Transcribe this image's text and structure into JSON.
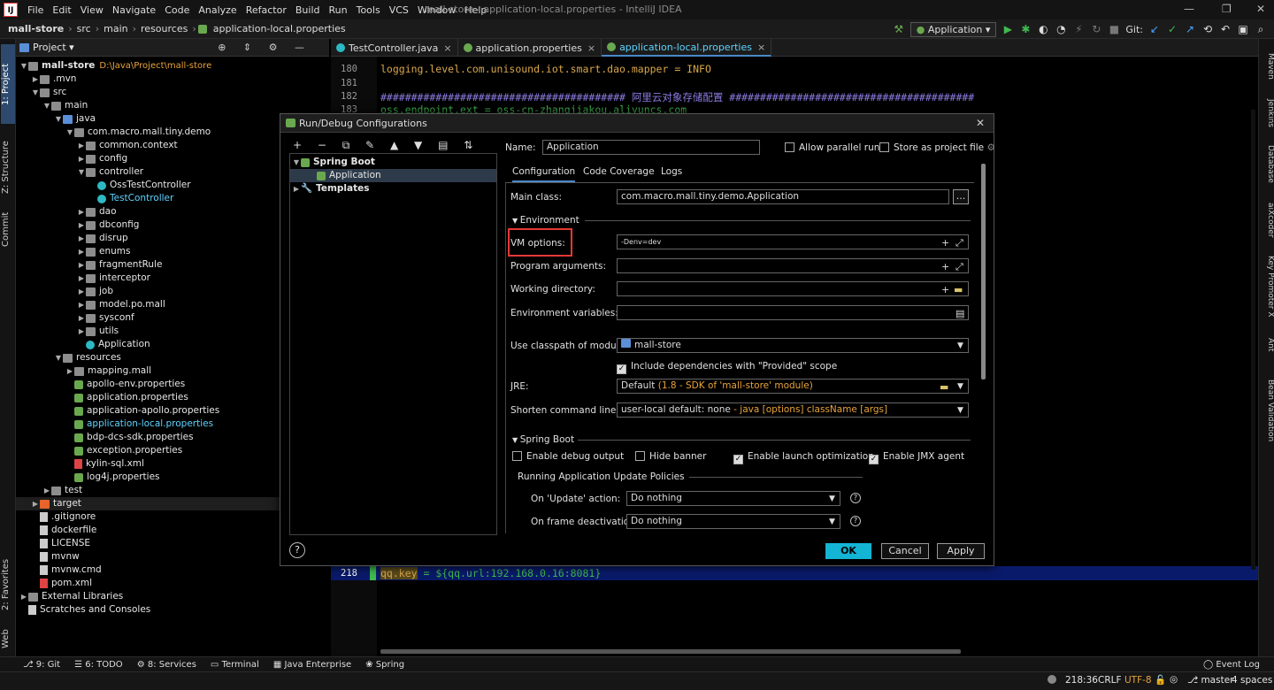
{
  "menubar": {
    "logo": "IJ",
    "items": [
      "File",
      "Edit",
      "View",
      "Navigate",
      "Code",
      "Analyze",
      "Refactor",
      "Build",
      "Run",
      "Tools",
      "VCS",
      "Window",
      "Help"
    ],
    "title": "mall-store - application-local.properties - IntelliJ IDEA",
    "minimize": "—",
    "maximize": "❐",
    "close": "✕"
  },
  "navbar": {
    "crumbs": [
      "mall-store",
      "src",
      "main",
      "resources",
      "application-local.properties"
    ],
    "run_config": "Application",
    "git_label": "Git:"
  },
  "left_strip": {
    "project": "1: Project",
    "structure": "Z: Structure",
    "commit": "Commit",
    "favorites": "2: Favorites",
    "web": "Web"
  },
  "right_strip": [
    "Maven",
    "Jenkins",
    "Database",
    "aiXcoder",
    "Key Promoter X",
    "Ant",
    "Bean Validation"
  ],
  "project_panel": {
    "header": "Project",
    "tree": [
      {
        "label": "mall-store",
        "suffix": "D:\\Java\\Project\\mall-store",
        "depth": 0,
        "arrow": "▼",
        "icon": "folder",
        "bold": true
      },
      {
        "label": ".mvn",
        "depth": 1,
        "arrow": "▶",
        "icon": "folder"
      },
      {
        "label": "src",
        "depth": 1,
        "arrow": "▼",
        "icon": "folder"
      },
      {
        "label": "main",
        "depth": 2,
        "arrow": "▼",
        "icon": "folder"
      },
      {
        "label": "java",
        "depth": 3,
        "arrow": "▼",
        "icon": "folderb"
      },
      {
        "label": "com.macro.mall.tiny.demo",
        "depth": 4,
        "arrow": "▼",
        "icon": "folder"
      },
      {
        "label": "common.context",
        "depth": 5,
        "arrow": "▶",
        "icon": "folder"
      },
      {
        "label": "config",
        "depth": 5,
        "arrow": "▶",
        "icon": "folder"
      },
      {
        "label": "controller",
        "depth": 5,
        "arrow": "▼",
        "icon": "folder"
      },
      {
        "label": "OssTestController",
        "depth": 6,
        "arrow": "",
        "icon": "cls"
      },
      {
        "label": "TestController",
        "depth": 6,
        "arrow": "",
        "icon": "cls",
        "color": "#5fd3ff"
      },
      {
        "label": "dao",
        "depth": 5,
        "arrow": "▶",
        "icon": "folder"
      },
      {
        "label": "dbconfig",
        "depth": 5,
        "arrow": "▶",
        "icon": "folder"
      },
      {
        "label": "disrup",
        "depth": 5,
        "arrow": "▶",
        "icon": "folder"
      },
      {
        "label": "enums",
        "depth": 5,
        "arrow": "▶",
        "icon": "folder"
      },
      {
        "label": "fragmentRule",
        "depth": 5,
        "arrow": "▶",
        "icon": "folder"
      },
      {
        "label": "interceptor",
        "depth": 5,
        "arrow": "▶",
        "icon": "folder"
      },
      {
        "label": "job",
        "depth": 5,
        "arrow": "▶",
        "icon": "folder"
      },
      {
        "label": "model.po.mall",
        "depth": 5,
        "arrow": "▶",
        "icon": "folder"
      },
      {
        "label": "sysconf",
        "depth": 5,
        "arrow": "▶",
        "icon": "folder"
      },
      {
        "label": "utils",
        "depth": 5,
        "arrow": "▶",
        "icon": "folder"
      },
      {
        "label": "Application",
        "depth": 5,
        "arrow": "",
        "icon": "cls"
      },
      {
        "label": "resources",
        "depth": 3,
        "arrow": "▼",
        "icon": "folder"
      },
      {
        "label": "mapping.mall",
        "depth": 4,
        "arrow": "▶",
        "icon": "folder"
      },
      {
        "label": "apollo-env.properties",
        "depth": 4,
        "arrow": "",
        "icon": "spr"
      },
      {
        "label": "application.properties",
        "depth": 4,
        "arrow": "",
        "icon": "spr"
      },
      {
        "label": "application-apollo.properties",
        "depth": 4,
        "arrow": "",
        "icon": "spr"
      },
      {
        "label": "application-local.properties",
        "depth": 4,
        "arrow": "",
        "icon": "spr",
        "color": "#5fd3ff"
      },
      {
        "label": "bdp-dcs-sdk.properties",
        "depth": 4,
        "arrow": "",
        "icon": "spr"
      },
      {
        "label": "exception.properties",
        "depth": 4,
        "arrow": "",
        "icon": "spr"
      },
      {
        "label": "kylin-sql.xml",
        "depth": 4,
        "arrow": "",
        "icon": "xml"
      },
      {
        "label": "log4j.properties",
        "depth": 4,
        "arrow": "",
        "icon": "spr"
      },
      {
        "label": "test",
        "depth": 2,
        "arrow": "▶",
        "icon": "folder"
      },
      {
        "label": "target",
        "depth": 1,
        "arrow": "▶",
        "icon": "folder",
        "highlight": true
      },
      {
        "label": ".gitignore",
        "depth": 1,
        "arrow": "",
        "icon": "file"
      },
      {
        "label": "dockerfile",
        "depth": 1,
        "arrow": "",
        "icon": "file"
      },
      {
        "label": "LICENSE",
        "depth": 1,
        "arrow": "",
        "icon": "file"
      },
      {
        "label": "mvnw",
        "depth": 1,
        "arrow": "",
        "icon": "file"
      },
      {
        "label": "mvnw.cmd",
        "depth": 1,
        "arrow": "",
        "icon": "file"
      },
      {
        "label": "pom.xml",
        "depth": 1,
        "arrow": "",
        "icon": "xml"
      },
      {
        "label": "External Libraries",
        "depth": 0,
        "arrow": "▶",
        "icon": "folder"
      },
      {
        "label": "Scratches and Consoles",
        "depth": 0,
        "arrow": "",
        "icon": "file"
      }
    ]
  },
  "editor": {
    "tabs": [
      {
        "label": "TestController.java",
        "color": "#2db9c4",
        "active": false
      },
      {
        "label": "application.properties",
        "color": "#6aa84f",
        "active": false
      },
      {
        "label": "application-local.properties",
        "color": "#6aa84f",
        "active": true
      }
    ],
    "lines": [
      {
        "n": "180",
        "text": "logging.level.com.unisound.iot.smart.dao.mapper = INFO",
        "color": "#d9a74a"
      },
      {
        "n": "181",
        "text": "",
        "color": "#d9a74a"
      },
      {
        "n": "182",
        "text": "######################################## 阿里云对象存储配置 ########################################",
        "color": "#8b7ae0"
      },
      {
        "n": "183",
        "text": "oss.endpoint.ext = oss-cn-zhangjiakou.aliyuncs.com",
        "color": "#3fb950"
      }
    ],
    "bottom_line": {
      "n": "218",
      "key": "qq.key",
      "rest": " = ${qq.url:192.168.0.16:8081}"
    }
  },
  "dialog": {
    "title": "Run/Debug Configurations",
    "tree": {
      "spring_boot": "Spring Boot",
      "application": "Application",
      "templates": "Templates"
    },
    "name_label": "Name:",
    "name_value": "Application",
    "allow_parallel": "Allow parallel run",
    "store_as_project": "Store as project file",
    "tabs": [
      "Configuration",
      "Code Coverage",
      "Logs"
    ],
    "main_class_label": "Main class:",
    "main_class_value": "com.macro.mall.tiny.demo.Application",
    "environment_section": "Environment",
    "vm_options_label": "VM options:",
    "vm_options_value": "-Denv=dev",
    "program_args_label": "Program arguments:",
    "working_dir_label": "Working directory:",
    "env_vars_label": "Environment variables:",
    "classpath_label": "Use classpath of module:",
    "classpath_value": "mall-store",
    "include_provided": "Include dependencies with \"Provided\" scope",
    "jre_label": "JRE:",
    "jre_value_main": "Default",
    "jre_value_detail": "(1.8 - SDK of 'mall-store' module)",
    "shorten_label": "Shorten command line:",
    "shorten_value_main": "user-local default: none",
    "shorten_value_detail": " - java [options] className [args]",
    "springboot_section": "Spring Boot",
    "enable_debug": "Enable debug output",
    "hide_banner": "Hide banner",
    "enable_launch_opt": "Enable launch optimization",
    "enable_jmx": "Enable JMX agent",
    "update_policies": "Running Application Update Policies",
    "on_update_label": "On 'Update' action:",
    "on_update_value": "Do nothing",
    "on_frame_label": "On frame deactivation:",
    "on_frame_value": "Do nothing",
    "ok": "OK",
    "cancel": "Cancel",
    "apply": "Apply",
    "help": "?"
  },
  "bottom_tabs": [
    "9: Git",
    "6: TODO",
    "8: Services",
    "Terminal",
    "Java Enterprise",
    "Spring"
  ],
  "event_log": "Event Log",
  "status": {
    "position": "218:36",
    "line_sep": "CRLF",
    "encoding": "UTF-8",
    "branch": "master",
    "indent": "4 spaces"
  },
  "colors": {
    "accent": "#4a88c7",
    "highlight_box": "#e53935",
    "ok_button": "#13b4d4",
    "selection": "#2d3a4a"
  }
}
